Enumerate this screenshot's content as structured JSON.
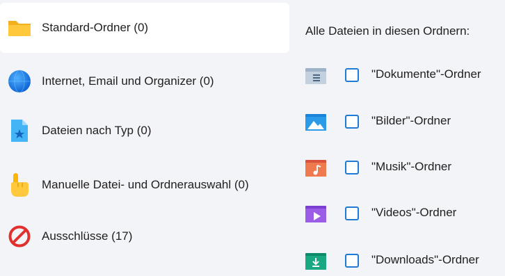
{
  "nav": {
    "items": [
      {
        "label": "Standard-Ordner (0)",
        "icon": "folder-icon",
        "selected": true
      },
      {
        "label": "Internet, Email und Organizer (0)",
        "icon": "globe-icon",
        "selected": false
      },
      {
        "label": "Dateien nach Typ (0)",
        "icon": "file-star-icon",
        "selected": false
      },
      {
        "label": "Manuelle Datei- und Ordnerauswahl (0)",
        "icon": "pointing-hand-icon",
        "selected": false
      },
      {
        "label": "Ausschlüsse (17)",
        "icon": "prohibited-icon",
        "selected": false
      }
    ]
  },
  "panel": {
    "heading": "Alle Dateien in diesen Ordnern:",
    "folders": [
      {
        "label": "\"Dokumente\"-Ordner",
        "icon": "documents-folder-icon",
        "checked": false
      },
      {
        "label": "\"Bilder\"-Ordner",
        "icon": "pictures-folder-icon",
        "checked": false
      },
      {
        "label": "\"Musik\"-Ordner",
        "icon": "music-folder-icon",
        "checked": false
      },
      {
        "label": "\"Videos\"-Ordner",
        "icon": "videos-folder-icon",
        "checked": false
      },
      {
        "label": "\"Downloads\"-Ordner",
        "icon": "downloads-folder-icon",
        "checked": false
      }
    ]
  },
  "colors": {
    "background": "#f3f4f8",
    "selected": "#ffffff",
    "checkbox_border": "#1f7ad6"
  }
}
